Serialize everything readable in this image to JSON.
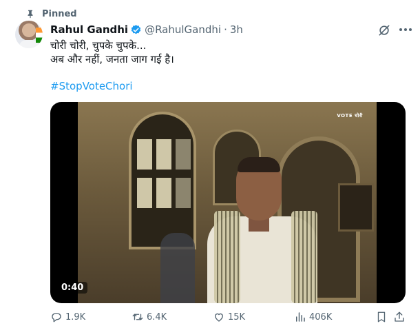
{
  "pinned": {
    "label": "Pinned"
  },
  "author": {
    "name": "Rahul Gandhi",
    "handle": "@RahulGandhi",
    "separator": "·",
    "time": "3h"
  },
  "tweet": {
    "line1": "चोरी चोरी, चुपके चुपके...",
    "line2": "अब और नहीं, जनता जाग गई है।",
    "hashtag": "#StopVoteChori"
  },
  "video": {
    "duration": "0:40",
    "watermark": "VOTE चोरी"
  },
  "actions": {
    "replies": "1.9K",
    "retweets": "6.4K",
    "likes": "15K",
    "views": "406K"
  },
  "colors": {
    "link": "#1d9bf0",
    "secondary_text": "#536471",
    "verified": "#1d9bf0"
  },
  "icons": [
    "pin-icon",
    "verified-badge-icon",
    "grok-icon",
    "more-icon",
    "reply-icon",
    "retweet-icon",
    "like-icon",
    "views-icon",
    "bookmark-icon",
    "share-icon"
  ]
}
